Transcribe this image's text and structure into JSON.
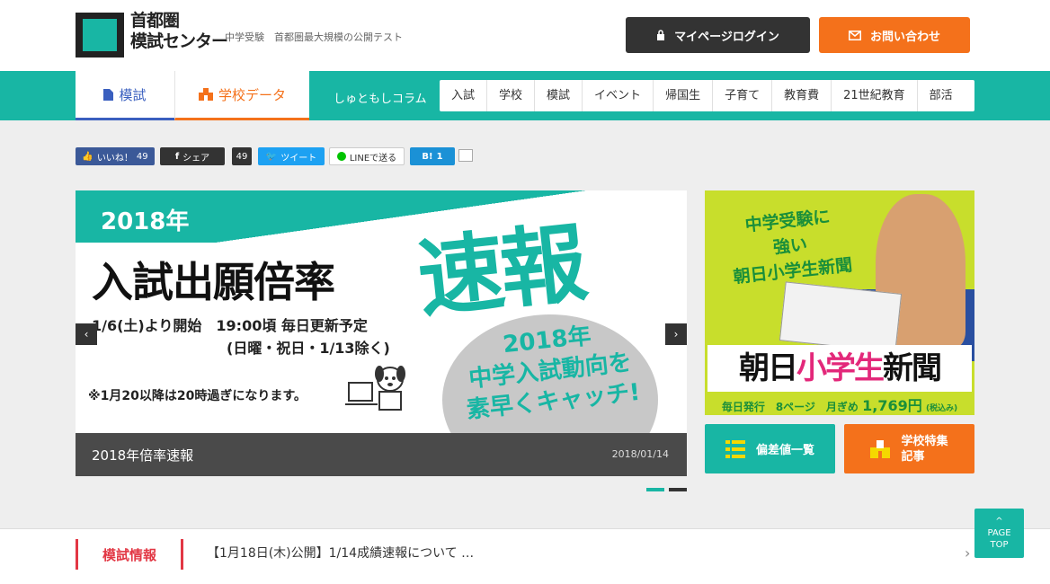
{
  "header": {
    "logo_line1": "首都圏",
    "logo_line2": "模試センター",
    "tagline": "中学受験　首都圏最大規模の公開テスト",
    "login_label": "マイページログイン",
    "contact_label": "お問い合わせ"
  },
  "nav": {
    "tab_moshi": "模試",
    "tab_gakko": "学校データ",
    "column_label": "しゅともしコラム",
    "categories": [
      "入試",
      "学校",
      "模試",
      "イベント",
      "帰国生",
      "子育て",
      "教育費",
      "21世紀教育",
      "部活"
    ]
  },
  "share": {
    "like": "いいね！",
    "like_count": "49",
    "share": "シェア",
    "share_count": "49",
    "tweet": "ツイート",
    "line": "LINEで送る",
    "hatena": "B!",
    "hatena_count": "1"
  },
  "slider": {
    "year": "2018年",
    "main": "入試出願倍率",
    "sokuho": "速報",
    "line1": "1/6(土)より開始　19:00頃 毎日更新予定",
    "line2": "(日曜・祝日・1/13除く)",
    "line3": "※1月20以降は20時過ぎになります。",
    "burst_line1": "2018年",
    "burst_line2": "中学入試動向を",
    "burst_line3": "素早くキャッチ!",
    "caption_title": "2018年倍率速報",
    "caption_date": "2018/01/14",
    "prev": "‹",
    "next": "›"
  },
  "ad": {
    "head_line1": "中学受験に",
    "head_line2": "強い",
    "head_line3": "朝日小学生新聞",
    "band_a": "朝日",
    "band_b": "小学生",
    "band_c": "新聞",
    "foot_text": "毎日発行　8ページ　月ぎめ",
    "foot_price": "1,769円",
    "foot_tax": "(税込み)"
  },
  "buttons": {
    "hensachi": "偏差値一覧",
    "tokushu_line1": "学校特集",
    "tokushu_line2": "記事"
  },
  "news": {
    "label": "模試情報",
    "text": "【1月18日(木)公開】1/14成績速報について …",
    "next": "›"
  },
  "page_top": {
    "line1": "PAGE",
    "line2": "TOP"
  },
  "colors": {
    "teal": "#18b6a4",
    "orange": "#f4711b",
    "dark": "#333333",
    "blue": "#3a5fbf",
    "red": "#e23744",
    "ad_green": "#c8de2c"
  }
}
